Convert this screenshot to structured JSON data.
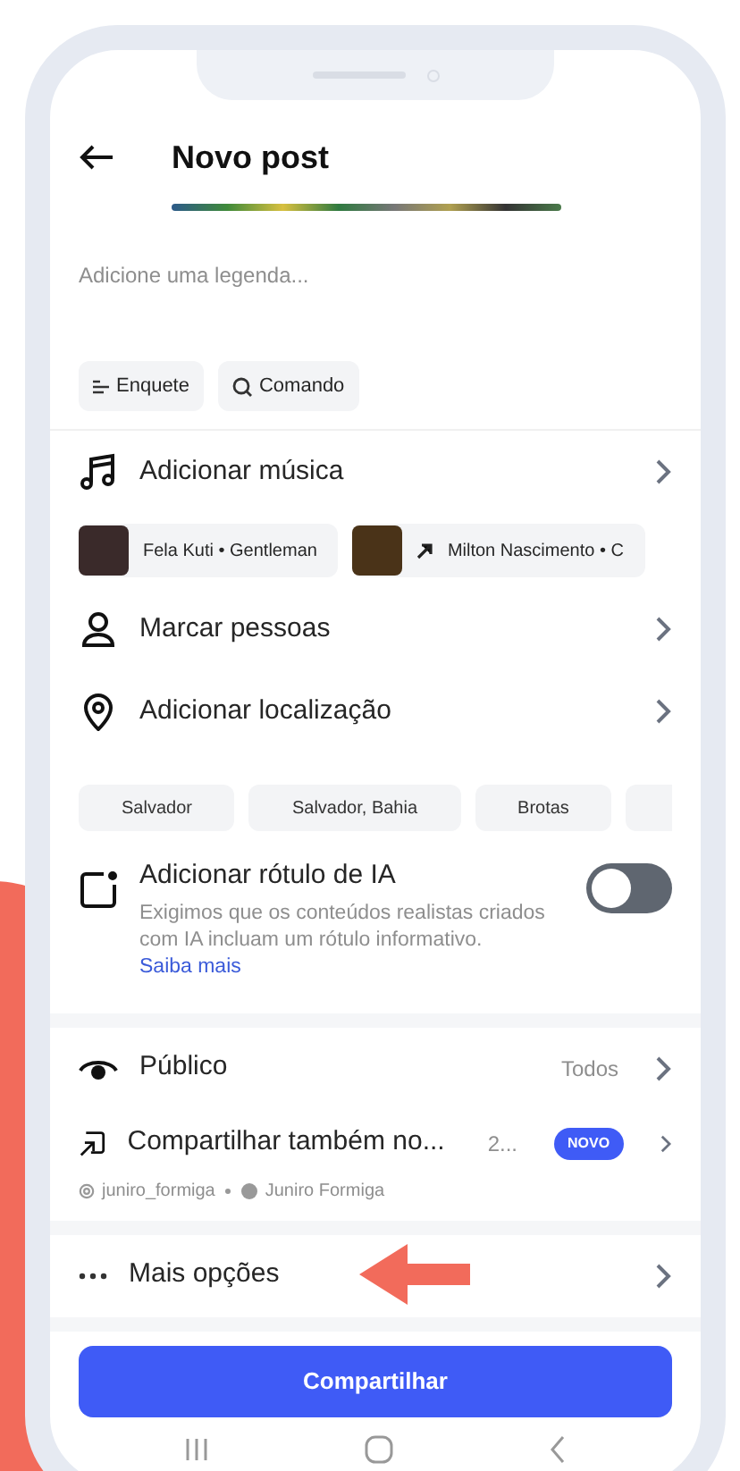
{
  "header": {
    "title": "Novo post"
  },
  "caption": {
    "placeholder": "Adicione uma legenda..."
  },
  "caption_tools": [
    {
      "kind": "poll",
      "label": "Enquete"
    },
    {
      "kind": "search",
      "label": "Comando"
    }
  ],
  "music": {
    "label": "Adicionar música"
  },
  "songs": [
    {
      "kind": "plain",
      "label": "Fela Kuti • Gentleman"
    },
    {
      "kind": "trending",
      "label": "Milton Nascimento • C"
    }
  ],
  "tag_people": {
    "label": "Marcar pessoas"
  },
  "location": {
    "label": "Adicionar localização"
  },
  "location_suggestions": [
    "Salvador",
    "Salvador, Bahia",
    "Brotas"
  ],
  "ai_label": {
    "title": "Adicionar rótulo de IA",
    "description": "Exigimos que os conteúdos realistas criados com IA incluam um rótulo informativo.",
    "link": "Saiba mais",
    "on": false
  },
  "audience": {
    "label": "Público",
    "value": "Todos"
  },
  "share_also": {
    "label": "Compartilhar também no...",
    "count": "2...",
    "badge": "NOVO",
    "accounts": [
      {
        "kind": "instagram",
        "name": "juniro_formiga"
      },
      {
        "kind": "facebook",
        "name": "Juniro Formiga"
      }
    ]
  },
  "more_options": {
    "label": "Mais opções"
  },
  "share_button": {
    "label": "Compartilhar"
  }
}
